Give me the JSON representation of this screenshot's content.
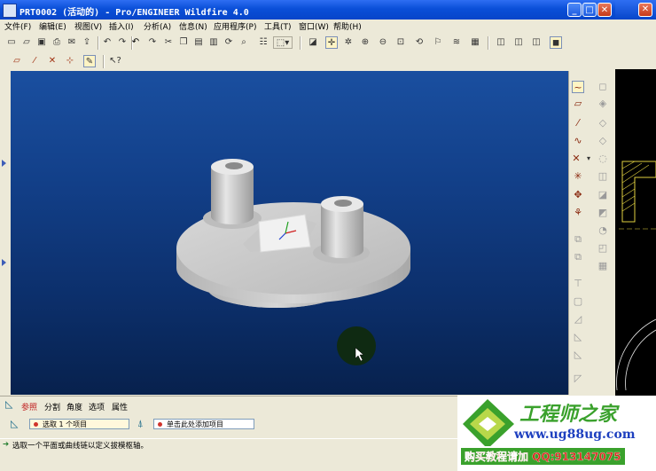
{
  "window": {
    "title": "PRT0002 (活动的) - Pro/ENGINEER Wildfire 4.0",
    "minimize_glyph": "_",
    "maximize_glyph": "□",
    "close_glyph": "✕"
  },
  "menu": [
    "文件(F)",
    "编辑(E)",
    "视图(V)",
    "插入(I)",
    "分析(A)",
    "信息(N)",
    "应用程序(P)",
    "工具(T)",
    "窗口(W)",
    "帮助(H)"
  ],
  "dashboard": {
    "tabs": [
      "参照",
      "分割",
      "角度",
      "选项",
      "属性"
    ],
    "selection_1": "选取 1 个项目",
    "selection_2": "单击此处添加项目"
  },
  "status_message": "选取一个平面或曲线链以定义拔模枢轴。",
  "ad": {
    "brand": "工程师之家",
    "url": "www.ug88ug.com",
    "banner": "购买教程请加 QQ:913147075"
  },
  "colors": {
    "titlebar": "#0a4fd8",
    "viewport_top": "#1a4fa0",
    "viewport_bottom": "#07214d",
    "ad_green": "#3aa12c",
    "ad_red": "#d9261c",
    "ad_blue": "#1d3fbf"
  },
  "icons": {
    "toolbar_row1": [
      "new-icon",
      "open-icon",
      "save-icon",
      "print-icon",
      "email-icon",
      "send-icon",
      "undo-icon",
      "redo-icon",
      "cut-icon",
      "copy-icon",
      "paste-icon",
      "paste-special-icon",
      "regenerate-icon",
      "select-box-icon",
      "datum-plane-display-icon",
      "axis-display-icon",
      "point-display-icon",
      "zoom-in-icon",
      "zoom-out-icon",
      "refit-icon",
      "reorient-icon",
      "saved-views-icon",
      "layers-icon",
      "view-manager-icon",
      "wireframe-icon",
      "hidden-line-icon",
      "no-hidden-icon",
      "shaded-icon"
    ],
    "toolbar_row2": [
      "plane-icon",
      "axis-icon",
      "point-icon",
      "coordinate-system-icon",
      "sketch-icon",
      "help-whats-this-icon"
    ]
  }
}
